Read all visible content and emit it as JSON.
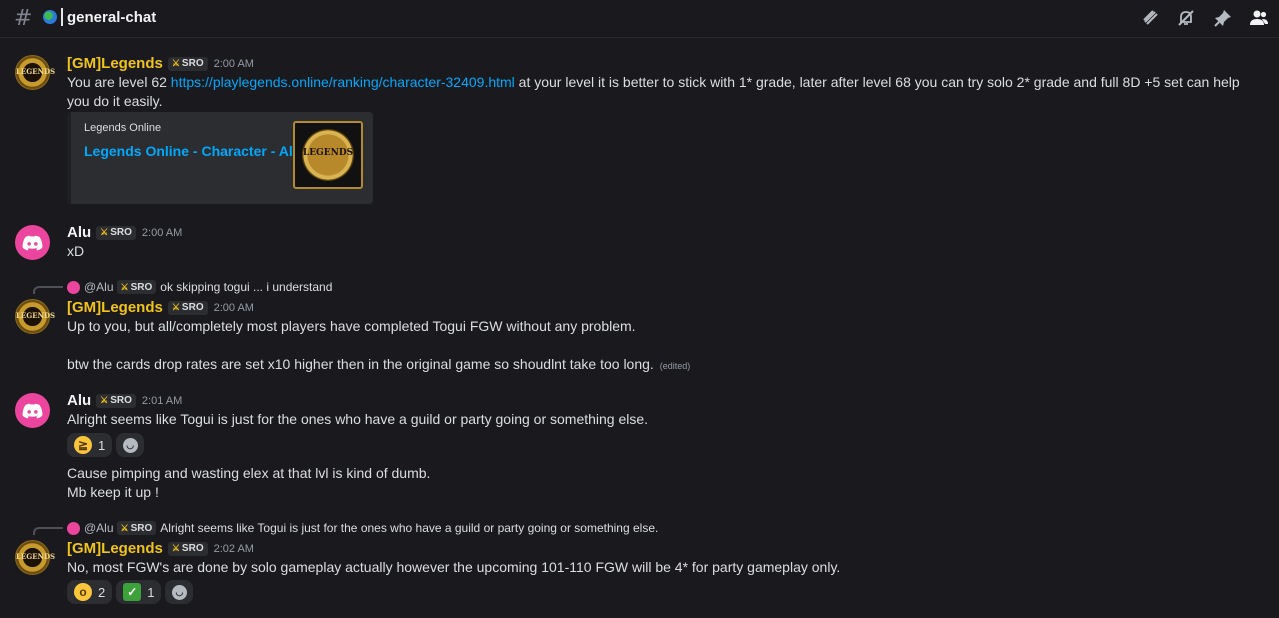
{
  "header": {
    "channel_name": "general-chat",
    "icons": [
      "threads-icon",
      "notifications-muted-icon",
      "pin-icon",
      "members-icon"
    ]
  },
  "tag": "SRO",
  "messages": [
    {
      "author": "[GM]Legends",
      "time": "2:00 AM",
      "text_prefix": "You are level 62 ",
      "link": "https://playlegends.online/ranking/character-32409.html",
      "text_suffix": " at your level it is better to stick with 1* grade, later after level 68 you can try solo 2* grade and full 8D +5 set can help you do it easily.",
      "embed": {
        "provider": "Legends Online",
        "title": "Legends Online - Character - Alu",
        "thumb_text": "LEGENDS"
      }
    },
    {
      "author": "Alu",
      "time": "2:00 AM",
      "text": "xD"
    },
    {
      "reply_to": {
        "name": "@Alu",
        "text": "ok skipping togui ... i understand"
      },
      "author": "[GM]Legends",
      "time": "2:00 AM",
      "text": "Up to you, but all/completely most players have completed Togui FGW without any problem.",
      "text2": "btw the cards drop rates are set x10 higher then in the original game so shoudlnt take too long.",
      "edited": "(edited)"
    },
    {
      "author": "Alu",
      "time": "2:01 AM",
      "text": "Alright seems like Togui is just for the ones who have a guild or party going or something else.",
      "reactions": [
        {
          "emoji": "laughing-emoji",
          "count": "1"
        }
      ],
      "text2": "Cause pimping and wasting elex at that lvl is kind of dumb.",
      "text3": "Mb keep it up !"
    },
    {
      "reply_to": {
        "name": "@Alu",
        "text": "Alright seems like Togui is just for the ones who have a guild or party going or something else."
      },
      "author": "[GM]Legends",
      "time": "2:02 AM",
      "text": "No, most FGW's are done by solo gameplay actually however the upcoming 101-110 FGW will be 4* for party gameplay only.",
      "reactions": [
        {
          "emoji": "hushed-face-emoji",
          "count": "2"
        },
        {
          "emoji": "check-mark-emoji",
          "count": "1"
        }
      ]
    }
  ]
}
